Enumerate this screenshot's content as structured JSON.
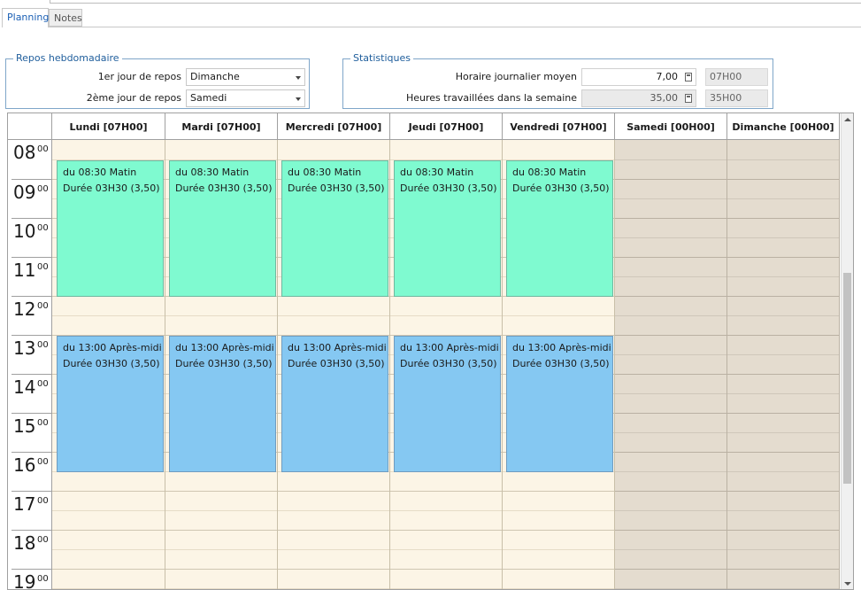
{
  "tabs": [
    {
      "label": "Planning"
    },
    {
      "label": "Notes"
    }
  ],
  "repos": {
    "title": "Repos hebdomadaire",
    "jour1_label": "1er jour de repos",
    "jour1_value": "Dimanche",
    "jour2_label": "2ème jour de repos",
    "jour2_value": "Samedi"
  },
  "stats": {
    "title": "Statistiques",
    "horaire_label": "Horaire journalier moyen",
    "horaire_value": "7,00",
    "horaire_hm": "07H00",
    "heures_label": "Heures travaillées dans la semaine",
    "heures_value": "35,00",
    "heures_hm": "35H00"
  },
  "days": [
    {
      "label": "Lundi [07H00]"
    },
    {
      "label": "Mardi [07H00]"
    },
    {
      "label": "Mercredi [07H00]"
    },
    {
      "label": "Jeudi [07H00]"
    },
    {
      "label": "Vendredi [07H00]"
    },
    {
      "label": "Samedi [00H00]"
    },
    {
      "label": "Dimanche [00H00]"
    }
  ],
  "hours": [
    {
      "h": "08",
      "m": "00"
    },
    {
      "h": "09",
      "m": "00"
    },
    {
      "h": "10",
      "m": "00"
    },
    {
      "h": "11",
      "m": "00"
    },
    {
      "h": "12",
      "m": "00"
    },
    {
      "h": "13",
      "m": "00"
    },
    {
      "h": "14",
      "m": "00"
    },
    {
      "h": "15",
      "m": "00"
    },
    {
      "h": "16",
      "m": "00"
    },
    {
      "h": "17",
      "m": "00"
    },
    {
      "h": "18",
      "m": "00"
    },
    {
      "h": "19",
      "m": "00"
    }
  ],
  "events": {
    "matin": {
      "line1": "du 08:30 Matin",
      "line2": "Durée 03H30 (3,50)"
    },
    "aprem": {
      "line1": "du 13:00 Après-midi",
      "line2": "Durée 03H30 (3,50)"
    }
  },
  "colors": {
    "matin": "#7ffad0",
    "aprem": "#85c8f2",
    "work_bg": "#fcf5e6",
    "rest_bg": "#e4dccf",
    "accent": "#1f5e9c"
  }
}
